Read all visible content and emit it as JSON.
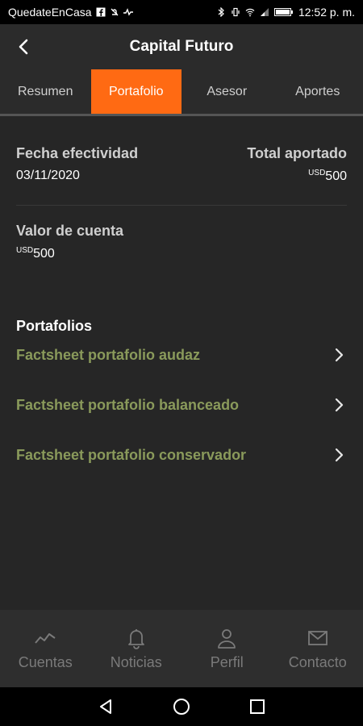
{
  "status_bar": {
    "carrier": "QuedateEnCasa",
    "time": "12:52 p. m."
  },
  "header": {
    "title": "Capital Futuro",
    "back_icon": "back-arrow-icon"
  },
  "tabs": [
    {
      "label": "Resumen",
      "active": false
    },
    {
      "label": "Portafolio",
      "active": true
    },
    {
      "label": "Asesor",
      "active": false
    },
    {
      "label": "Aportes",
      "active": false
    }
  ],
  "accent_color": "#ff6a13",
  "link_color": "#8a9a5b",
  "summary": {
    "fecha_label": "Fecha efectividad",
    "fecha_value": "03/11/2020",
    "total_label": "Total aportado",
    "total_currency": "USD",
    "total_value": "500",
    "valor_label": "Valor de cuenta",
    "valor_currency": "USD",
    "valor_value": "500"
  },
  "portfolios": {
    "title": "Portafolios",
    "items": [
      {
        "label": "Factsheet portafolio audaz"
      },
      {
        "label": "Factsheet portafolio balanceado"
      },
      {
        "label": "Factsheet portafolio conservador"
      }
    ]
  },
  "bottom_nav": [
    {
      "label": "Cuentas",
      "icon": "chart-line-icon"
    },
    {
      "label": "Noticias",
      "icon": "bell-icon"
    },
    {
      "label": "Perfil",
      "icon": "user-icon"
    },
    {
      "label": "Contacto",
      "icon": "mail-icon"
    }
  ]
}
